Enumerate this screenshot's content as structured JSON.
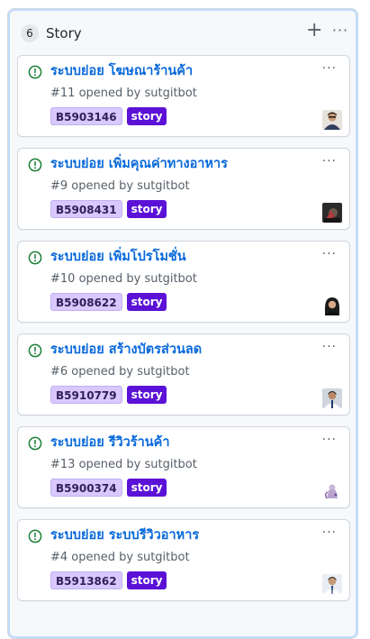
{
  "column": {
    "title": "Story",
    "count": "6",
    "add_icon": "plus-icon",
    "more_icon": "kebab-horizontal-icon"
  },
  "colors": {
    "link": "#0969da",
    "open_issue": "#1a7f37",
    "story_label": "#5b12d6",
    "code_label": "#d8c8ff"
  },
  "cards": [
    {
      "title": "ระบบย่อย โฆษณาร้านค้า",
      "meta": "#11 opened by sutgitbot",
      "code": "B5903146",
      "label": "story",
      "status_icon": "issue-opened-icon",
      "avatar_icon": "user-avatar-icon"
    },
    {
      "title": "ระบบย่อย เพิ่มคุณค่าทางอาหาร",
      "meta": "#9 opened by sutgitbot",
      "code": "B5908431",
      "label": "story",
      "status_icon": "issue-opened-icon",
      "avatar_icon": "user-avatar-icon"
    },
    {
      "title": "ระบบย่อย เพิ่มโปรโมชั่น",
      "meta": "#10 opened by sutgitbot",
      "code": "B5908622",
      "label": "story",
      "status_icon": "issue-opened-icon",
      "avatar_icon": "user-avatar-icon"
    },
    {
      "title": "ระบบย่อย สร้างบัตรส่วนลด",
      "meta": "#6 opened by sutgitbot",
      "code": "B5910779",
      "label": "story",
      "status_icon": "issue-opened-icon",
      "avatar_icon": "user-avatar-icon"
    },
    {
      "title": "ระบบย่อย รีวิวร้านค้า",
      "meta": "#13 opened by sutgitbot",
      "code": "B5900374",
      "label": "story",
      "status_icon": "issue-opened-icon",
      "avatar_icon": "user-avatar-icon"
    },
    {
      "title": "ระบบย่อย ระบบรีวิวอาหาร",
      "meta": "#4 opened by sutgitbot",
      "code": "B5913862",
      "label": "story",
      "status_icon": "issue-opened-icon",
      "avatar_icon": "user-avatar-icon"
    }
  ]
}
